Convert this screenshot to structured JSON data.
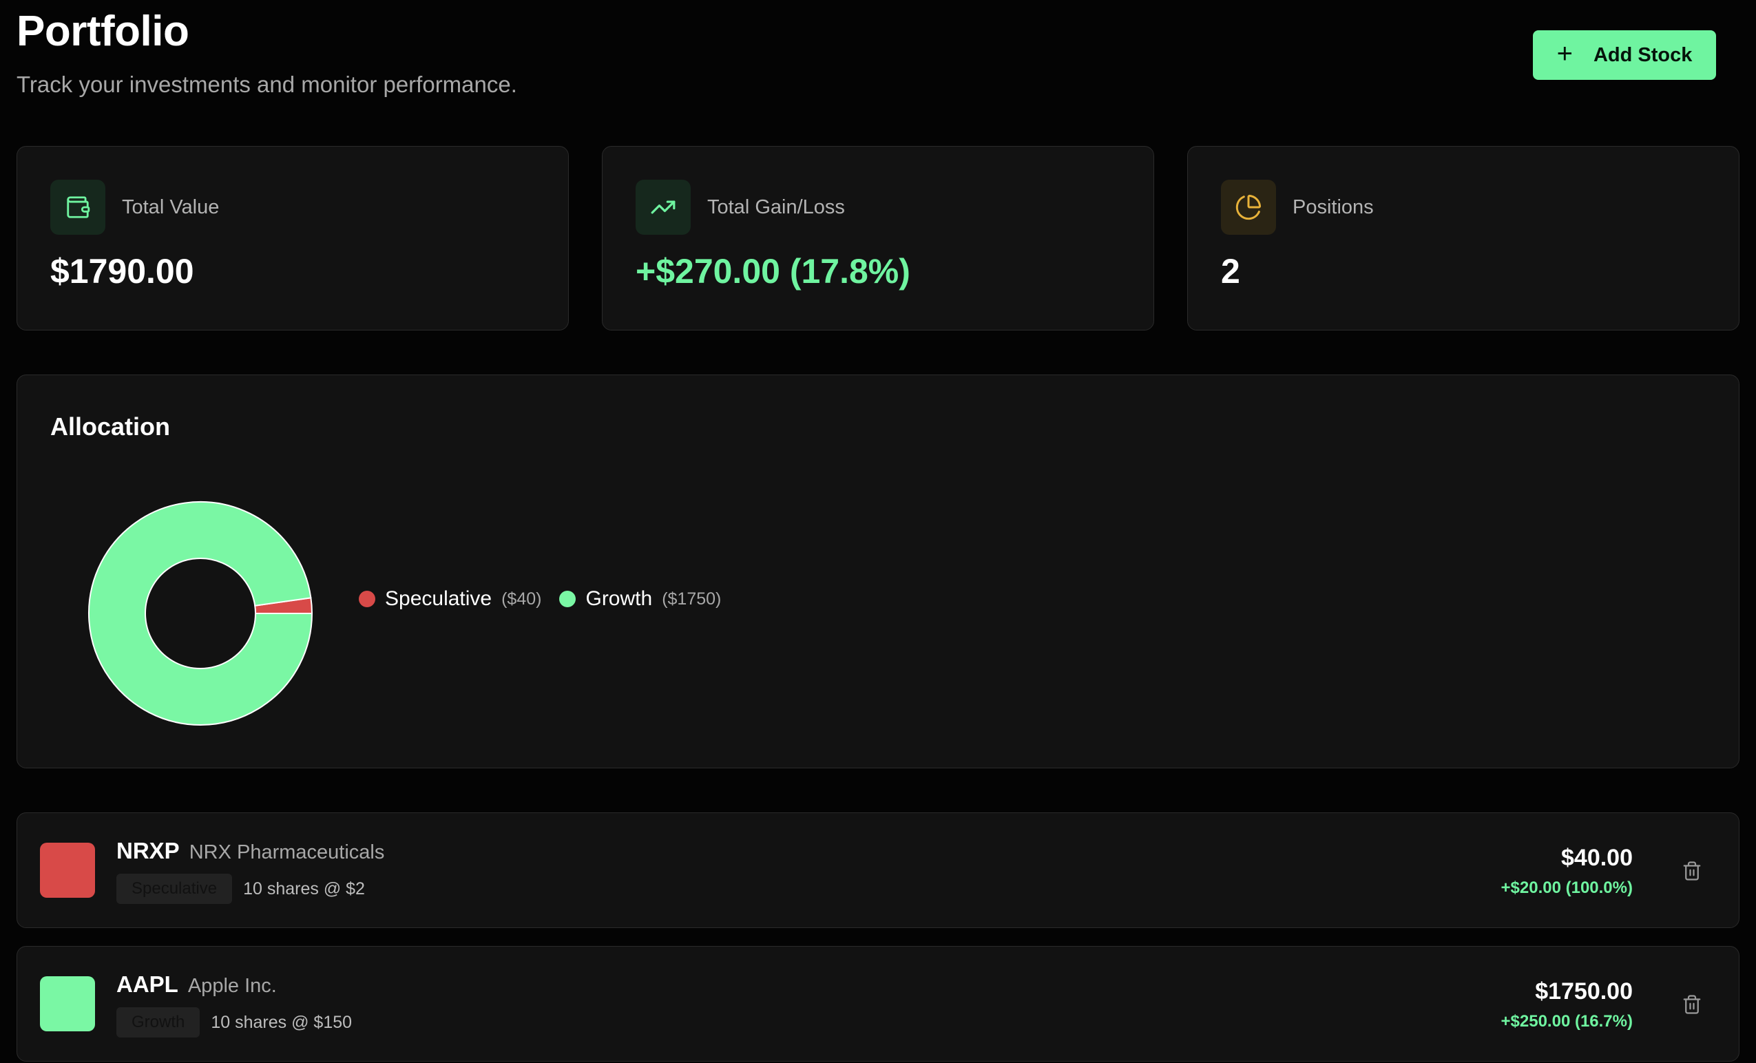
{
  "header": {
    "title": "Portfolio",
    "subtitle": "Track your investments and monitor performance.",
    "add_button_label": "Add Stock"
  },
  "stats": [
    {
      "label": "Total Value",
      "value": "$1790.00",
      "icon": "wallet-icon",
      "accent": "#6ff4a0"
    },
    {
      "label": "Total Gain/Loss",
      "value": "+$270.00 (17.8%)",
      "icon": "trending-up-icon",
      "accent": "#6ff4a0"
    },
    {
      "label": "Positions",
      "value": "2",
      "icon": "pie-chart-icon",
      "accent": "#e8b23a"
    }
  ],
  "allocation": {
    "title": "Allocation",
    "legend": [
      {
        "name": "Speculative",
        "value_label": "($40)",
        "color": "#d84a48"
      },
      {
        "name": "Growth",
        "value_label": "($1750)",
        "color": "#7af7a4"
      }
    ]
  },
  "chart_data": {
    "type": "pie",
    "variant": "donut",
    "labels": [
      "Speculative",
      "Growth"
    ],
    "values": [
      40,
      1750
    ],
    "colors": [
      "#d84a48",
      "#7af7a4"
    ],
    "title": "Allocation",
    "legend_position": "right"
  },
  "stocks": [
    {
      "ticker": "NRXP",
      "name": "NRX Pharmaceuticals",
      "category": "Speculative",
      "shares_text": "10 shares @ $2",
      "value": "$40.00",
      "gain": "+$20.00 (100.0%)",
      "color": "#d84a48"
    },
    {
      "ticker": "AAPL",
      "name": "Apple Inc.",
      "category": "Growth",
      "shares_text": "10 shares @ $150",
      "value": "$1750.00",
      "gain": "+$250.00 (16.7%)",
      "color": "#7af7a4"
    }
  ]
}
